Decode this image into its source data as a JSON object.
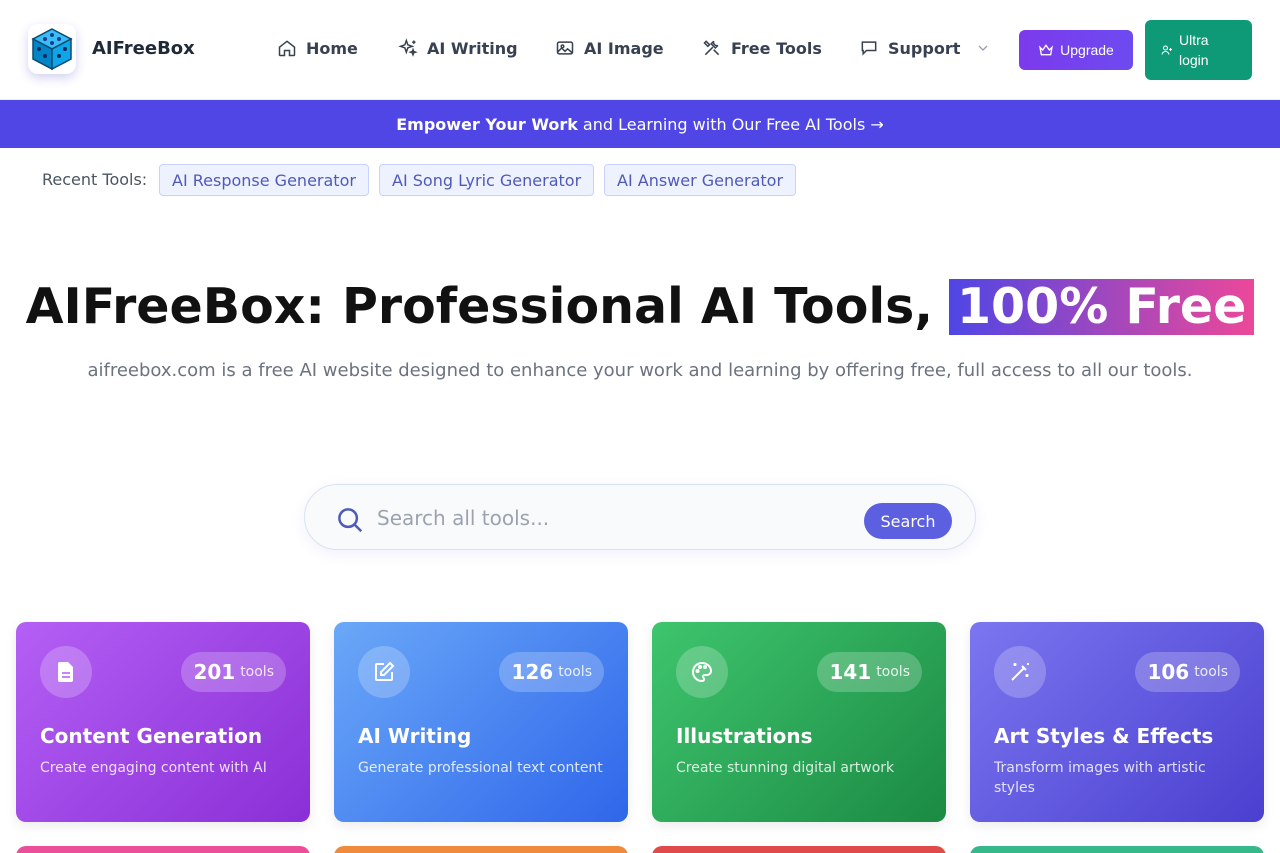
{
  "header": {
    "brand": "AIFreeBox",
    "nav": [
      {
        "label": "Home",
        "icon": "home-icon"
      },
      {
        "label": "AI Writing",
        "icon": "sparkles-icon"
      },
      {
        "label": "AI Image",
        "icon": "image-icon"
      },
      {
        "label": "Free Tools",
        "icon": "tools-icon"
      },
      {
        "label": "Support",
        "icon": "chat-icon"
      }
    ],
    "upgrade_label": "Upgrade",
    "login_label_line1": "Ultra",
    "login_label_line2": "login"
  },
  "banner": {
    "bold": "Empower Your Work",
    "text": "and Learning with Our Free AI Tools →"
  },
  "recent": {
    "label": "Recent Tools:",
    "items": [
      "AI Response Generator",
      "AI Song Lyric Generator",
      "AI Answer Generator"
    ]
  },
  "hero": {
    "title": "AIFreeBox: Professional AI Tools,",
    "highlight": "100% Free",
    "subtitle": "aifreebox.com is a free AI website designed to enhance your work and learning by offering free, full access to all our tools."
  },
  "search": {
    "placeholder": "Search all tools...",
    "button_label": "Search"
  },
  "cards": [
    {
      "title": "Content Generation",
      "desc": "Create engaging content with AI",
      "count": "201",
      "unit": "tools",
      "icon": "document-icon",
      "color_from": "#b45ff5",
      "color_to": "#8a2fd6"
    },
    {
      "title": "AI Writing",
      "desc": "Generate professional text content",
      "count": "126",
      "unit": "tools",
      "icon": "edit-icon",
      "color_from": "#6aa8f8",
      "color_to": "#2f66ea"
    },
    {
      "title": "Illustrations",
      "desc": "Create stunning digital artwork",
      "count": "141",
      "unit": "tools",
      "icon": "palette-icon",
      "color_from": "#3ec56d",
      "color_to": "#1b8a44"
    },
    {
      "title": "Art Styles & Effects",
      "desc": "Transform images with artistic styles",
      "count": "106",
      "unit": "tools",
      "icon": "magic-wand-icon",
      "color_from": "#7b76f0",
      "color_to": "#4a3fcf"
    }
  ],
  "card_strip_colors": [
    "#ec4f9a",
    "#f08a3c",
    "#e04a4a",
    "#35b98a"
  ]
}
